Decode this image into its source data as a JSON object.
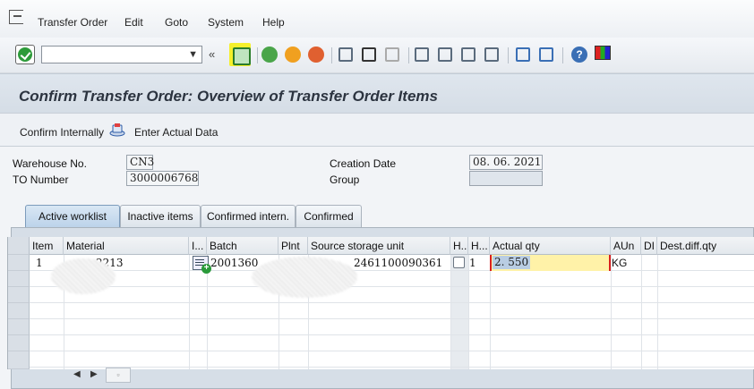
{
  "menu": {
    "items": [
      {
        "label": "Transfer Order"
      },
      {
        "label": "Edit"
      },
      {
        "label": "Goto"
      },
      {
        "label": "System"
      },
      {
        "label": "Help"
      }
    ]
  },
  "toolbar": {
    "command_value": "",
    "colors": {
      "save_highlight": "#f5f02a",
      "ok": "#2d9b3a"
    }
  },
  "page": {
    "title": "Confirm Transfer Order: Overview of Transfer Order Items"
  },
  "app_toolbar": {
    "confirm_internally": "Confirm Internally",
    "enter_actual_data": "Enter Actual Data"
  },
  "header": {
    "warehouse_label": "Warehouse No.",
    "warehouse_value": "CN3",
    "to_number_label": "TO Number",
    "to_number_value": "3000006768",
    "creation_date_label": "Creation Date",
    "creation_date_value": "08. 06. 2021",
    "group_label": "Group",
    "group_value": ""
  },
  "tabs": [
    {
      "label": "Active worklist",
      "active": true
    },
    {
      "label": "Inactive items",
      "active": false
    },
    {
      "label": "Confirmed intern.",
      "active": false
    },
    {
      "label": "Confirmed",
      "active": false
    }
  ],
  "table": {
    "columns": [
      "Item",
      "Material",
      "I...",
      "Batch",
      "Plnt",
      "Source storage unit",
      "H..",
      "H...",
      "Actual qty",
      "AUn",
      "DI",
      "Dest.diff.qty"
    ],
    "rows": [
      {
        "item": "1",
        "material": "2213",
        "batch": "2001360",
        "plnt": "",
        "source_su": "2461100090361",
        "h2": "1",
        "actual_qty": "2. 550",
        "aun": "KG"
      }
    ]
  },
  "nav": {
    "prev": "◀",
    "next": "▶",
    "scroll": "▫"
  }
}
